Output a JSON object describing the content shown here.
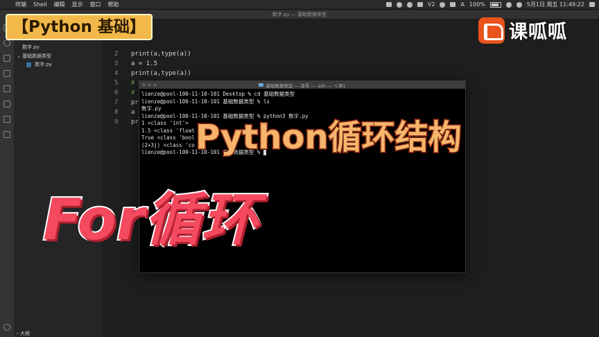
{
  "menubar": {
    "items": [
      "终端",
      "Shell",
      "编辑",
      "显示",
      "窗口",
      "帮助"
    ],
    "status_text": "100%",
    "date_time": "5月1日 周五  11:49:22",
    "v2": "V2",
    "a": "A"
  },
  "window": {
    "title": "数字.py — 基础数据类型"
  },
  "sidebar": {
    "open_file": "数字.py",
    "folder": "基础数据类型",
    "file": "数字.py",
    "outline": "大纲"
  },
  "editor": {
    "line_numbers": [
      "2",
      "3",
      "4",
      "5",
      "6",
      "7",
      "8",
      "9"
    ],
    "lines": [
      "print(a,type(a))",
      "a = 1.5",
      "print(a,type(a))",
      "#",
      "#",
      "pr",
      "a",
      "pr"
    ]
  },
  "terminal": {
    "title": "基础数据类型 — 泽哥 — -zsh — ⌥⌘1",
    "lines": [
      "lienze@pool-100-11-10-101 Desktop % cd 基础数据类型",
      "lienze@pool-100-11-10-101 基础数据类型 % ls",
      "数字.py",
      "lienze@pool-100-11-10-101 基础数据类型 % python3 数字.py",
      "1 <class 'int'>",
      "1.5 <class 'float",
      "True <class 'bool",
      "(2+3j) <class 'co",
      "lienze@pool-100-11-10-101 基础数据类型 %"
    ]
  },
  "overlay": {
    "badge": "【Python 基础】",
    "logo_text": "课呱呱",
    "subtitle": "Python循环结构",
    "title": "For循环"
  },
  "colors": {
    "badge_bg": "#f2b94a",
    "logo_bg": "#e8541c",
    "subtitle": "#f7b56c",
    "title": "#f4495e"
  }
}
